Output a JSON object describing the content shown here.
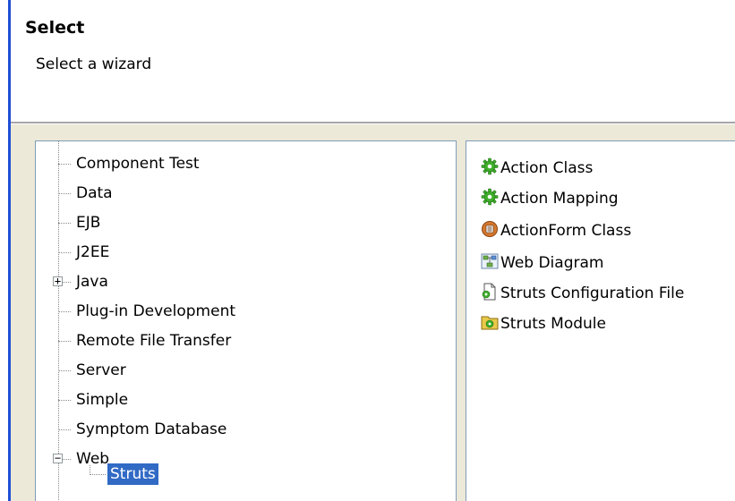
{
  "header": {
    "title": "Select",
    "description": "Select a wizard"
  },
  "tree": {
    "items": [
      {
        "label": "Component Test"
      },
      {
        "label": "Data"
      },
      {
        "label": "EJB"
      },
      {
        "label": "J2EE"
      },
      {
        "label": "Java",
        "expander": "+"
      },
      {
        "label": "Plug-in Development"
      },
      {
        "label": "Remote File Transfer"
      },
      {
        "label": "Server"
      },
      {
        "label": "Simple"
      },
      {
        "label": "Symptom Database"
      },
      {
        "label": "Web",
        "expander": "−"
      }
    ],
    "selected_child": "Struts"
  },
  "wizards": [
    {
      "label": "Action Class",
      "icon": "gear-icon"
    },
    {
      "label": "Action Mapping",
      "icon": "gear-icon"
    },
    {
      "label": "ActionForm Class",
      "icon": "form-class-icon"
    },
    {
      "label": "Web Diagram",
      "icon": "web-diagram-icon"
    },
    {
      "label": "Struts Configuration File",
      "icon": "config-file-icon"
    },
    {
      "label": "Struts Module",
      "icon": "module-icon"
    }
  ],
  "colors": {
    "accent_bar": "#1f4fd6",
    "selection": "#316ac5",
    "dialog_bg": "#ece9d8"
  }
}
